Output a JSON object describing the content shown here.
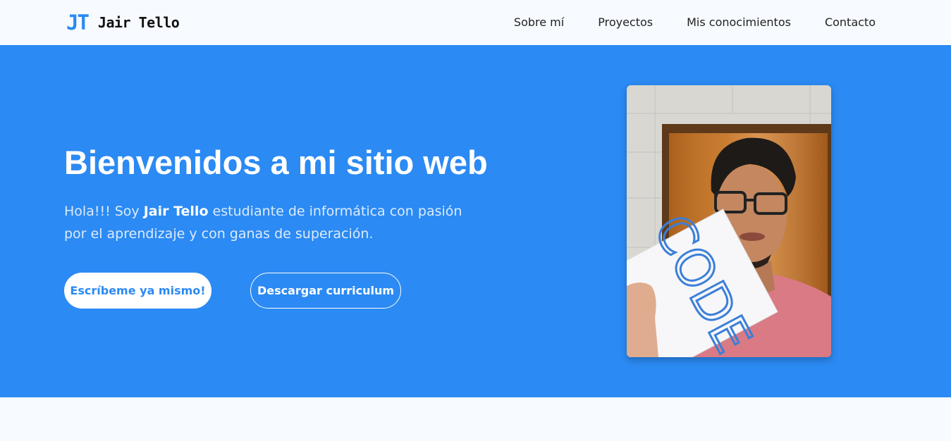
{
  "brand": {
    "mark": "JT",
    "name": "Jair Tello",
    "accent_color": "#2b8af3"
  },
  "nav": {
    "items": [
      {
        "label": "Sobre mí"
      },
      {
        "label": "Proyectos"
      },
      {
        "label": "Mis conocimientos"
      },
      {
        "label": "Contacto"
      }
    ]
  },
  "hero": {
    "title": "Bienvenidos a mi sitio web",
    "intro_prefix": "Hola!!! Soy ",
    "intro_name": "Jair Tello",
    "intro_suffix": " estudiante de informática con pasión por el aprendizaje y con ganas de superación.",
    "primary_button": "Escríbeme ya mismo!",
    "secondary_button": "Descargar curriculum",
    "background_color": "#2b8af3",
    "photo": {
      "sign_text": "CODE",
      "icon": "profile-photo"
    }
  }
}
